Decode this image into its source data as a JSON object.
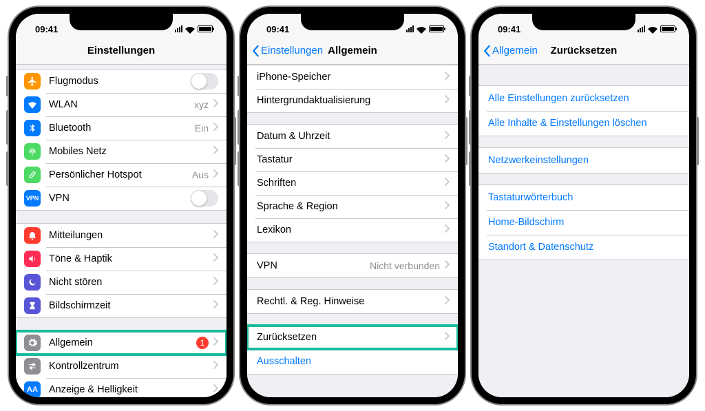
{
  "status": {
    "time": "09:41"
  },
  "phone1": {
    "title": "Einstellungen",
    "groups": [
      [
        {
          "icon": "airplane",
          "iconColor": "#ff9500",
          "label": "Flugmodus",
          "type": "toggle"
        },
        {
          "icon": "wifi",
          "iconColor": "#007aff",
          "label": "WLAN",
          "value": "xyz",
          "type": "disclosure"
        },
        {
          "icon": "bluetooth",
          "iconColor": "#007aff",
          "label": "Bluetooth",
          "value": "Ein",
          "type": "disclosure"
        },
        {
          "icon": "antenna",
          "iconColor": "#4cd964",
          "label": "Mobiles Netz",
          "type": "disclosure"
        },
        {
          "icon": "link",
          "iconColor": "#4cd964",
          "label": "Persönlicher Hotspot",
          "value": "Aus",
          "type": "disclosure"
        },
        {
          "icon": "vpn",
          "iconColor": "#007aff",
          "label": "VPN",
          "type": "toggle"
        }
      ],
      [
        {
          "icon": "bell",
          "iconColor": "#ff3b30",
          "label": "Mitteilungen",
          "type": "disclosure"
        },
        {
          "icon": "speaker",
          "iconColor": "#ff2d55",
          "label": "Töne & Haptik",
          "type": "disclosure"
        },
        {
          "icon": "moon",
          "iconColor": "#5856d6",
          "label": "Nicht stören",
          "type": "disclosure"
        },
        {
          "icon": "hourglass",
          "iconColor": "#5856d6",
          "label": "Bildschirmzeit",
          "type": "disclosure"
        }
      ],
      [
        {
          "icon": "gear",
          "iconColor": "#8e8e93",
          "label": "Allgemein",
          "badge": "1",
          "type": "disclosure",
          "highlight": true
        },
        {
          "icon": "switches",
          "iconColor": "#8e8e93",
          "label": "Kontrollzentrum",
          "type": "disclosure"
        },
        {
          "icon": "aa",
          "iconColor": "#007aff",
          "label": "Anzeige & Helligkeit",
          "type": "disclosure"
        }
      ]
    ]
  },
  "phone2": {
    "back": "Einstellungen",
    "title": "Allgemein",
    "groups": [
      [
        {
          "label": "iPhone-Speicher",
          "type": "disclosure"
        },
        {
          "label": "Hintergrundaktualisierung",
          "type": "disclosure"
        }
      ],
      [
        {
          "label": "Datum & Uhrzeit",
          "type": "disclosure"
        },
        {
          "label": "Tastatur",
          "type": "disclosure"
        },
        {
          "label": "Schriften",
          "type": "disclosure"
        },
        {
          "label": "Sprache & Region",
          "type": "disclosure"
        },
        {
          "label": "Lexikon",
          "type": "disclosure"
        }
      ],
      [
        {
          "label": "VPN",
          "value": "Nicht verbunden",
          "type": "disclosure"
        }
      ],
      [
        {
          "label": "Rechtl. & Reg. Hinweise",
          "type": "disclosure"
        }
      ],
      [
        {
          "label": "Zurücksetzen",
          "type": "disclosure",
          "highlight": true
        },
        {
          "label": "Ausschalten",
          "type": "plain",
          "blue": true
        }
      ]
    ]
  },
  "phone3": {
    "back": "Allgemein",
    "title": "Zurücksetzen",
    "groups": [
      [
        {
          "label": "Alle Einstellungen zurücksetzen",
          "type": "plain",
          "blue": true
        },
        {
          "label": "Alle Inhalte & Einstellungen löschen",
          "type": "plain",
          "blue": true
        }
      ],
      [
        {
          "label": "Netzwerkeinstellungen",
          "type": "plain",
          "blue": true
        }
      ],
      [
        {
          "label": "Tastaturwörterbuch",
          "type": "plain",
          "blue": true
        },
        {
          "label": "Home-Bildschirm",
          "type": "plain",
          "blue": true
        },
        {
          "label": "Standort & Datenschutz",
          "type": "plain",
          "blue": true
        }
      ]
    ]
  }
}
